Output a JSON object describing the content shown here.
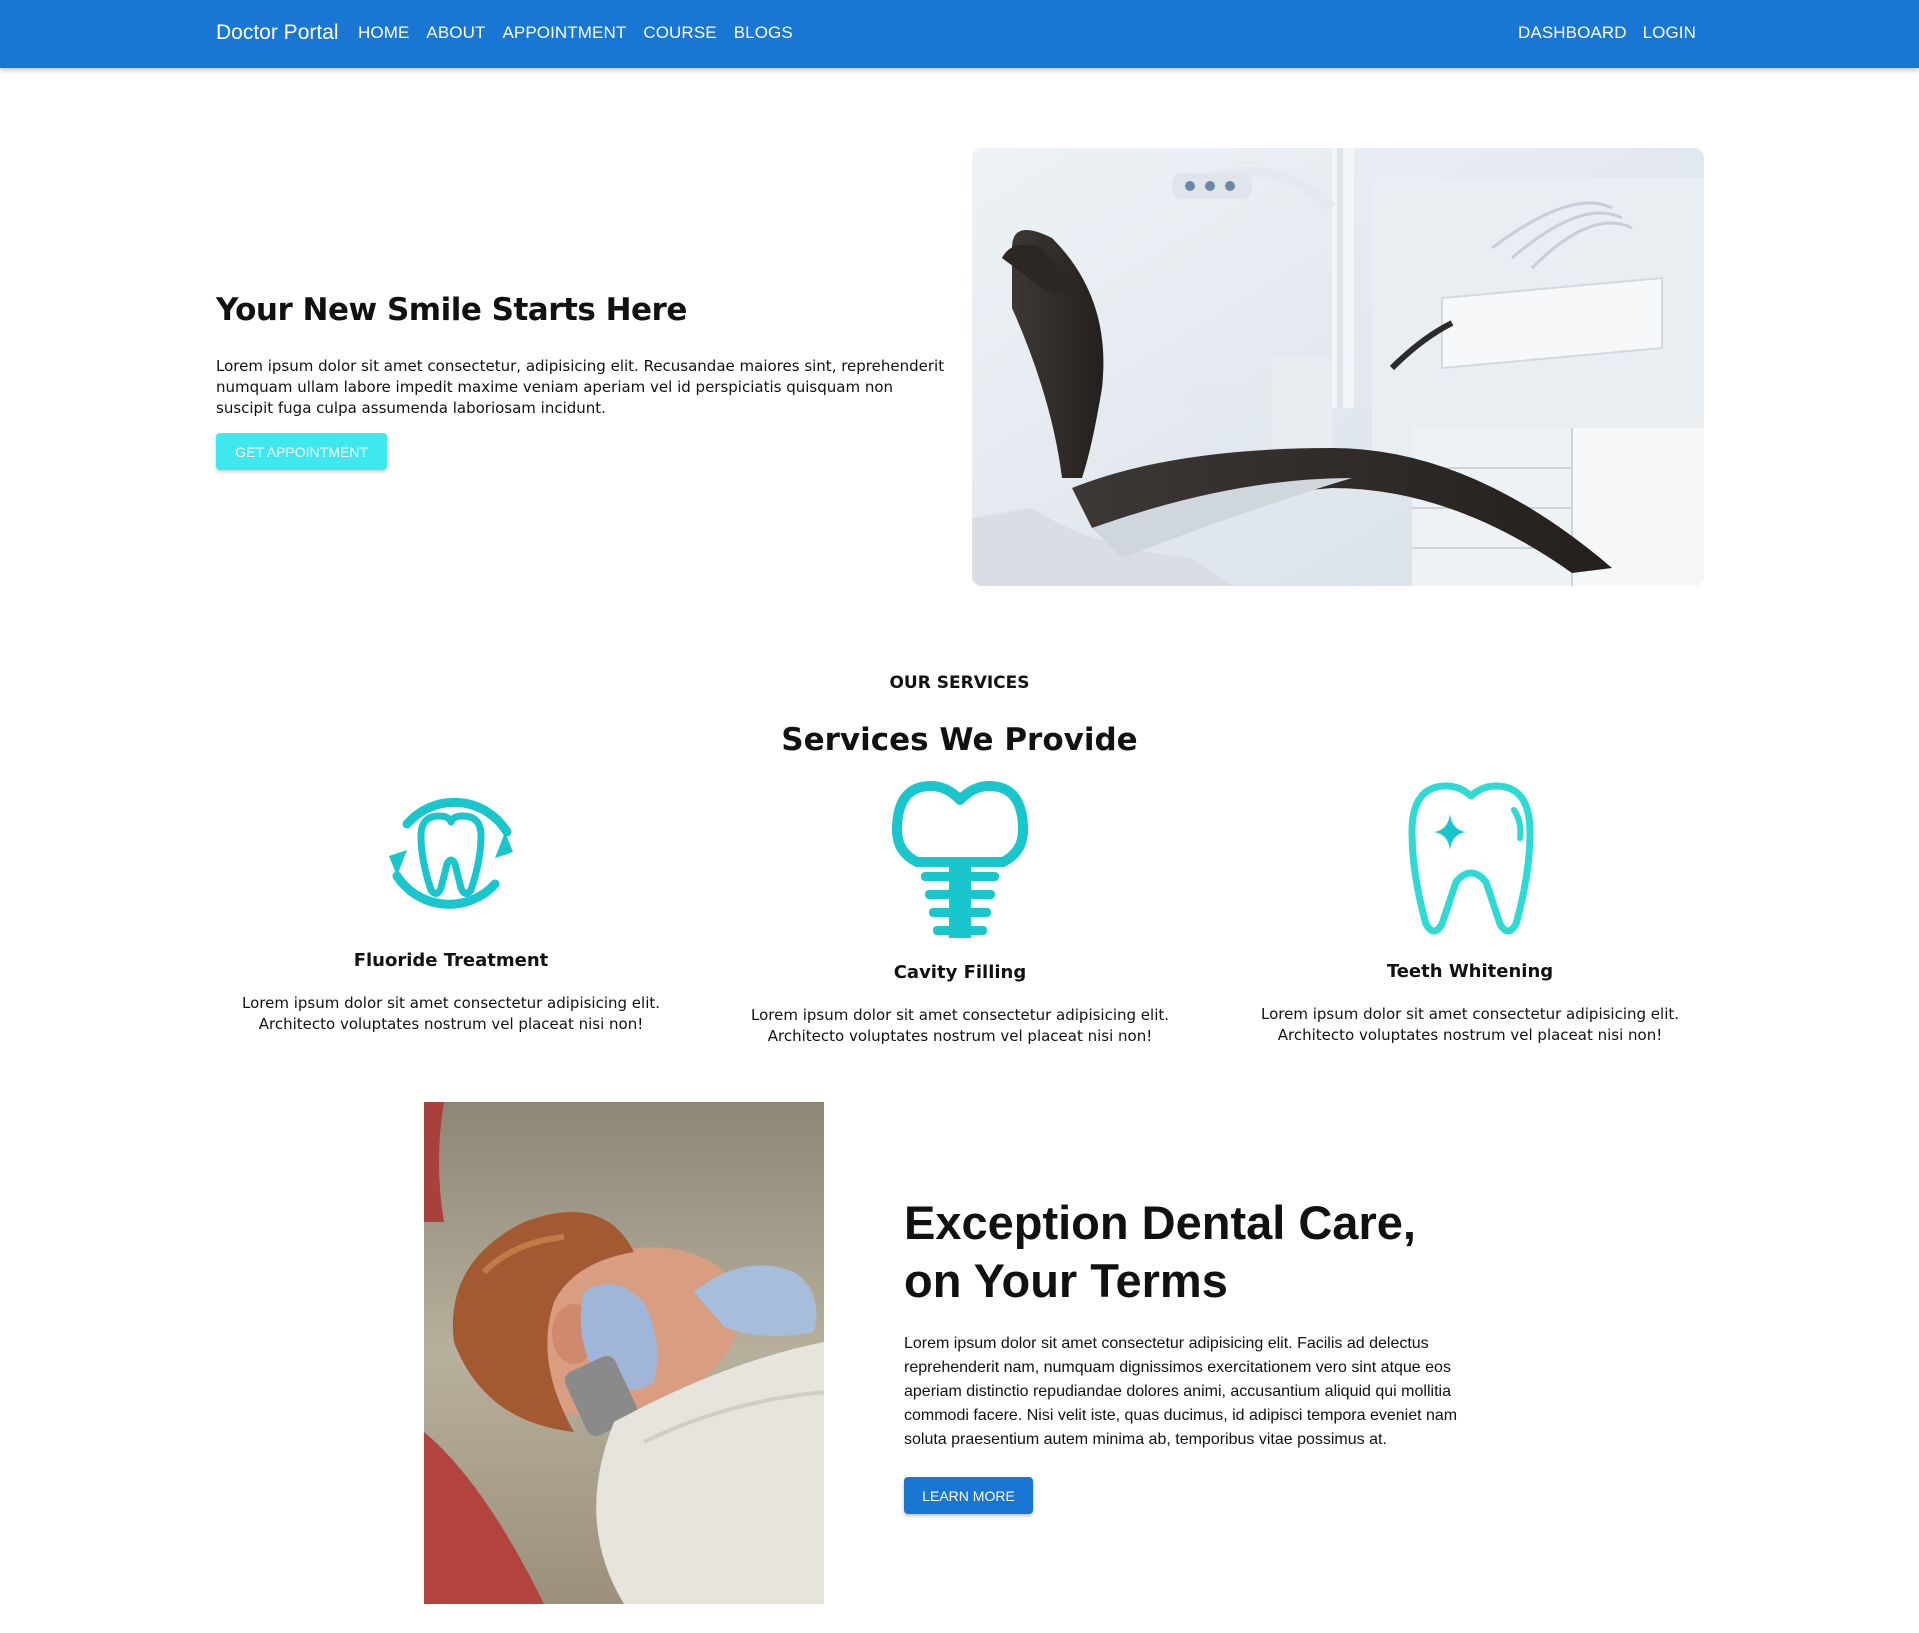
{
  "nav": {
    "brand": "Doctor Portal",
    "left_links": [
      "HOME",
      "ABOUT",
      "APPOINTMENT",
      "COURSE",
      "BLOGS"
    ],
    "right_links": [
      "DASHBOARD",
      "LOGIN"
    ],
    "bg_color": "#1976d2"
  },
  "hero": {
    "title": "Your New Smile Starts Here",
    "text": "Lorem ipsum dolor sit amet consectetur, adipisicing elit. Recusandae maiores sint, reprehenderit numquam ullam labore impedit maxime veniam aperiam vel id perspiciatis quisquam non suscipit fuga culpa assumenda laboriosam incidunt.",
    "button_label": "GET APPOINTMENT",
    "button_color": "#3ee8ee"
  },
  "services": {
    "eyebrow": "OUR SERVICES",
    "title": "Services We Provide",
    "items": [
      {
        "name": "Fluoride Treatment",
        "icon": "tooth-refresh-icon",
        "desc": "Lorem ipsum dolor sit amet consectetur adipisicing elit. Architecto voluptates nostrum vel placeat nisi non!"
      },
      {
        "name": "Cavity Filling",
        "icon": "dental-implant-icon",
        "desc": "Lorem ipsum dolor sit amet consectetur adipisicing elit. Architecto voluptates nostrum vel placeat nisi non!"
      },
      {
        "name": "Teeth Whitening",
        "icon": "sparkle-tooth-icon",
        "desc": "Lorem ipsum dolor sit amet consectetur adipisicing elit. Architecto voluptates nostrum vel placeat nisi non!"
      }
    ],
    "icon_color": "#19c6cc"
  },
  "care": {
    "title": "Exception Dental Care, on Your Terms",
    "text": "Lorem ipsum dolor sit amet consectetur adipisicing elit. Facilis ad delectus reprehenderit nam, numquam dignissimos exercitationem vero sint atque eos aperiam distinctio repudiandae dolores animi, accusantium aliquid qui mollitia commodi facere. Nisi velit iste, quas ducimus, id adipisci tempora eveniet nam soluta praesentium autem minima ab, temporibus vitae possimus at.",
    "button_label": "LEARN MORE"
  }
}
